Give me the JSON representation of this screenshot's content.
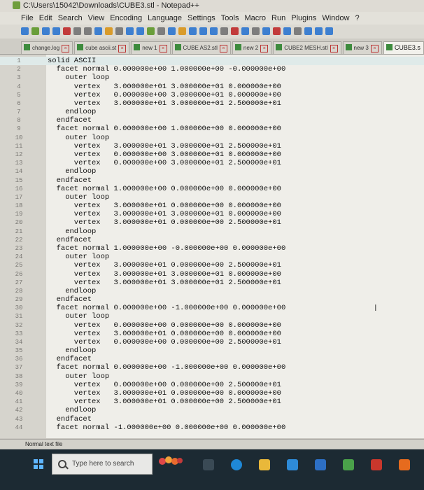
{
  "window": {
    "title": "C:\\Users\\15042\\Downloads\\CUBE3.stl - Notepad++"
  },
  "menu": [
    "File",
    "Edit",
    "Search",
    "View",
    "Encoding",
    "Language",
    "Settings",
    "Tools",
    "Macro",
    "Run",
    "Plugins",
    "Window",
    "?"
  ],
  "tabs": [
    {
      "label": "change.log",
      "active": false
    },
    {
      "label": "cube ascii.st",
      "active": false
    },
    {
      "label": "new 1",
      "active": false
    },
    {
      "label": "CUBE AS2.stl",
      "active": false
    },
    {
      "label": "new 2",
      "active": false
    },
    {
      "label": "CUBE2 MESH.stl",
      "active": false
    },
    {
      "label": "new 3",
      "active": false
    },
    {
      "label": "CUBE3.s",
      "active": true
    }
  ],
  "lines": [
    {
      "n": "1",
      "t": "solid ASCII"
    },
    {
      "n": "2",
      "t": "  facet normal 0.000000e+00 1.000000e+00 -0.000000e+00"
    },
    {
      "n": "3",
      "t": "    outer loop"
    },
    {
      "n": "4",
      "t": "      vertex   3.000000e+01 3.000000e+01 0.000000e+00"
    },
    {
      "n": "5",
      "t": "      vertex   0.000000e+00 3.000000e+01 0.000000e+00"
    },
    {
      "n": "6",
      "t": "      vertex   3.000000e+01 3.000000e+01 2.500000e+01"
    },
    {
      "n": "7",
      "t": "    endloop"
    },
    {
      "n": "8",
      "t": "  endfacet"
    },
    {
      "n": "9",
      "t": "  facet normal 0.000000e+00 1.000000e+00 0.000000e+00"
    },
    {
      "n": "10",
      "t": "    outer loop"
    },
    {
      "n": "11",
      "t": "      vertex   3.000000e+01 3.000000e+01 2.500000e+01"
    },
    {
      "n": "12",
      "t": "      vertex   0.000000e+00 3.000000e+01 0.000000e+00"
    },
    {
      "n": "13",
      "t": "      vertex   0.000000e+00 3.000000e+01 2.500000e+01"
    },
    {
      "n": "14",
      "t": "    endloop"
    },
    {
      "n": "15",
      "t": "  endfacet"
    },
    {
      "n": "16",
      "t": "  facet normal 1.000000e+00 0.000000e+00 0.000000e+00"
    },
    {
      "n": "17",
      "t": "    outer loop"
    },
    {
      "n": "18",
      "t": "      vertex   3.000000e+01 0.000000e+00 0.000000e+00"
    },
    {
      "n": "19",
      "t": "      vertex   3.000000e+01 3.000000e+01 0.000000e+00"
    },
    {
      "n": "20",
      "t": "      vertex   3.000000e+01 0.000000e+00 2.500000e+01"
    },
    {
      "n": "21",
      "t": "    endloop"
    },
    {
      "n": "22",
      "t": "  endfacet"
    },
    {
      "n": "23",
      "t": "  facet normal 1.000000e+00 -0.000000e+00 0.000000e+00"
    },
    {
      "n": "24",
      "t": "    outer loop"
    },
    {
      "n": "25",
      "t": "      vertex   3.000000e+01 0.000000e+00 2.500000e+01"
    },
    {
      "n": "26",
      "t": "      vertex   3.000000e+01 3.000000e+01 0.000000e+00"
    },
    {
      "n": "27",
      "t": "      vertex   3.000000e+01 3.000000e+01 2.500000e+01"
    },
    {
      "n": "28",
      "t": "    endloop"
    },
    {
      "n": "29",
      "t": "  endfacet"
    },
    {
      "n": "30",
      "t": "  facet normal 0.000000e+00 -1.000000e+00 0.000000e+00"
    },
    {
      "n": "31",
      "t": "    outer loop"
    },
    {
      "n": "32",
      "t": "      vertex   0.000000e+00 0.000000e+00 0.000000e+00"
    },
    {
      "n": "33",
      "t": "      vertex   3.000000e+01 0.000000e+00 0.000000e+00"
    },
    {
      "n": "34",
      "t": "      vertex   0.000000e+00 0.000000e+00 2.500000e+01"
    },
    {
      "n": "35",
      "t": "    endloop"
    },
    {
      "n": "36",
      "t": "  endfacet"
    },
    {
      "n": "37",
      "t": "  facet normal 0.000000e+00 -1.000000e+00 0.000000e+00"
    },
    {
      "n": "38",
      "t": "    outer loop"
    },
    {
      "n": "39",
      "t": "      vertex   0.000000e+00 0.000000e+00 2.500000e+01"
    },
    {
      "n": "40",
      "t": "      vertex   3.000000e+01 0.000000e+00 0.000000e+00"
    },
    {
      "n": "41",
      "t": "      vertex   3.000000e+01 0.000000e+00 2.500000e+01"
    },
    {
      "n": "42",
      "t": "    endloop"
    },
    {
      "n": "43",
      "t": "  endfacet"
    },
    {
      "n": "44",
      "t": "  facet normal -1.000000e+00 0.000000e+00 0.000000e+00"
    }
  ],
  "status": {
    "file_type": "Normal text file"
  },
  "taskbar": {
    "search_placeholder": "Type here to search"
  },
  "colors": {
    "editor_bg": "#efeee9",
    "gutter_bg": "#d6d4cd",
    "taskbar_bg": "#1c2a33"
  }
}
